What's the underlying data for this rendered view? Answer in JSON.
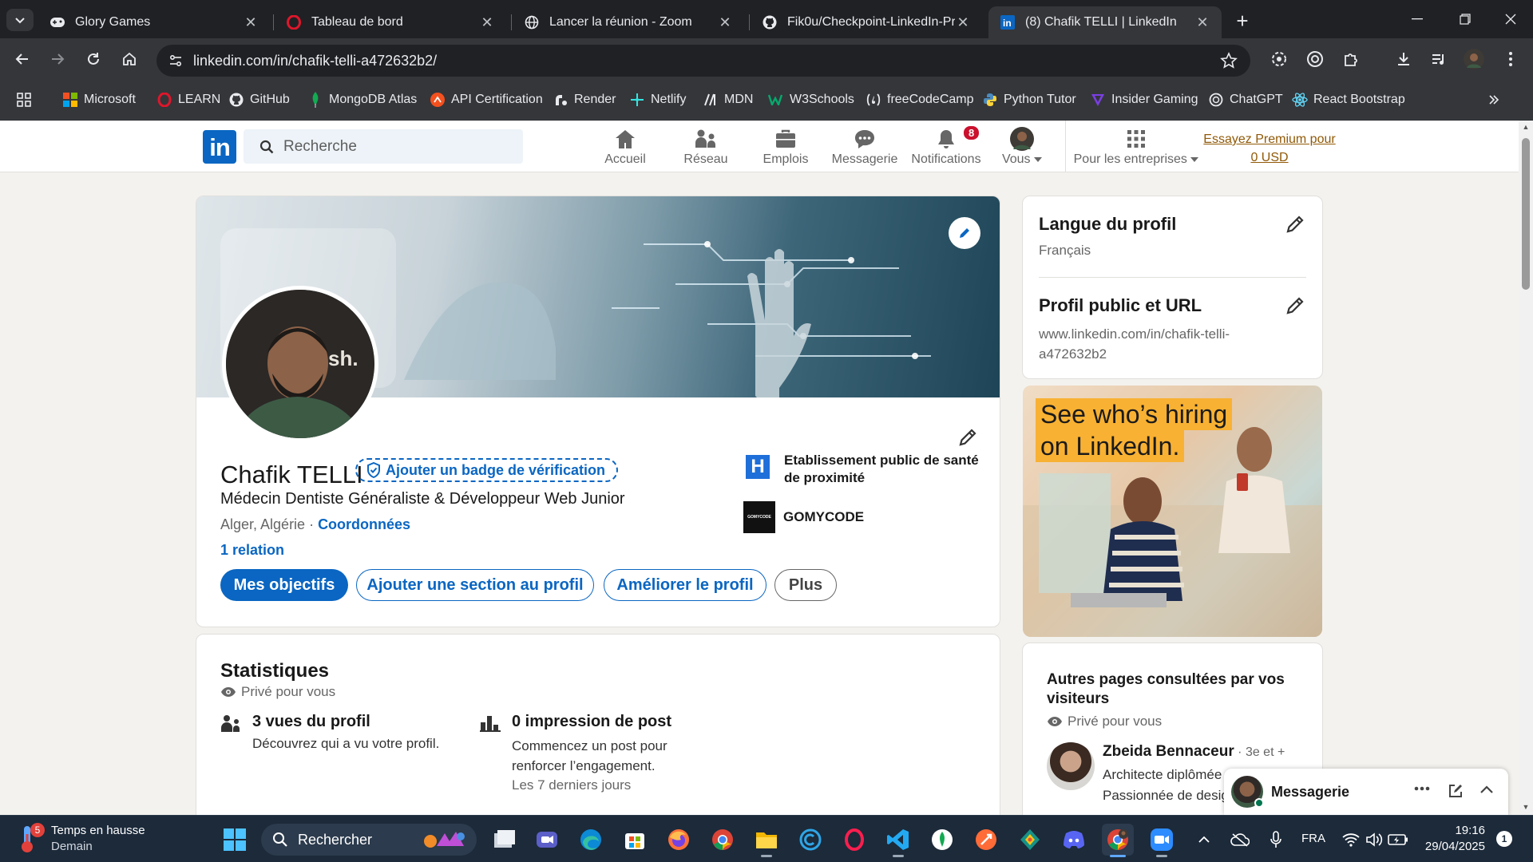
{
  "browser": {
    "tabs": [
      {
        "title": "Glory Games",
        "icon": "gamepad-icon",
        "active": false
      },
      {
        "title": "Tableau de bord",
        "icon": "opera-icon",
        "active": false
      },
      {
        "title": "Lancer la réunion - Zoom",
        "icon": "globe-icon",
        "active": false
      },
      {
        "title": "Fik0u/Checkpoint-LinkedIn-Pro",
        "icon": "github-icon",
        "active": false
      },
      {
        "title": "(8) Chafik TELLI | LinkedIn",
        "icon": "linkedin-icon",
        "active": true
      }
    ],
    "url": "linkedin.com/in/chafik-telli-a472632b2/",
    "bookmarks": [
      {
        "label": "Microsoft",
        "icon": "microsoft-icon",
        "color": "#f25022"
      },
      {
        "label": "LEARN",
        "icon": "opera-icon",
        "color": "#e0162b"
      },
      {
        "label": "GitHub",
        "icon": "github-icon",
        "color": "#ffffff"
      },
      {
        "label": "MongoDB Atlas",
        "icon": "mongodb-icon",
        "color": "#13aa52"
      },
      {
        "label": "API Certification",
        "icon": "api-icon",
        "color": "#f4511e"
      },
      {
        "label": "Render",
        "icon": "render-icon",
        "color": "#ffffff"
      },
      {
        "label": "Netlify",
        "icon": "netlify-icon",
        "color": "#32e6e2"
      },
      {
        "label": "MDN",
        "icon": "mdn-icon",
        "color": "#ffffff"
      },
      {
        "label": "W3Schools",
        "icon": "w3schools-icon",
        "color": "#04aa6d"
      },
      {
        "label": "freeCodeCamp",
        "icon": "freecodecamp-icon",
        "color": "#ffffff"
      },
      {
        "label": "Python Tutor",
        "icon": "python-icon",
        "color": "#4b8bbe"
      },
      {
        "label": "Insider Gaming",
        "icon": "insider-gaming-icon",
        "color": "#7b3fe4"
      },
      {
        "label": "ChatGPT",
        "icon": "chatgpt-icon",
        "color": "#ffffff"
      },
      {
        "label": "React Bootstrap",
        "icon": "react-icon",
        "color": "#61dafb"
      }
    ]
  },
  "linkedin": {
    "search_placeholder": "Recherche",
    "nav": [
      {
        "label": "Accueil",
        "icon": "home-icon"
      },
      {
        "label": "Réseau",
        "icon": "network-icon"
      },
      {
        "label": "Emplois",
        "icon": "briefcase-icon"
      },
      {
        "label": "Messagerie",
        "icon": "messaging-icon"
      },
      {
        "label": "Notifications",
        "icon": "bell-icon",
        "badge": "8"
      },
      {
        "label": "Vous",
        "icon": "avatar-icon"
      },
      {
        "label": "Pour les entreprises",
        "icon": "grid-icon"
      }
    ],
    "premium_line1": "Essayez Premium pour",
    "premium_line2": "0 USD",
    "accent": "#0a66c2"
  },
  "profile": {
    "name": "Chafik TELLI",
    "verify_badge": "Ajouter un badge de vérification",
    "headline": "Médecin Dentiste Généraliste & Développeur Web Junior",
    "location": "Alger, Algérie · ",
    "contact_link": "Coordonnées",
    "connections": "1 relation",
    "buttons": {
      "objectives": "Mes objectifs",
      "add_section": "Ajouter une section au profil",
      "improve": "Améliorer le profil",
      "more": "Plus"
    },
    "orgs": [
      {
        "name": "Etablissement public de santé de proximité",
        "logo_text": "H"
      },
      {
        "name": "GOMYCODE",
        "logo_text": "GOMYCODE"
      }
    ]
  },
  "stats": {
    "title": "Statistiques",
    "privacy": "Privé pour vous",
    "views_title": "3 vues du profil",
    "views_desc": "Découvrez qui a vu votre profil.",
    "impressions_title": "0 impression de post",
    "impressions_desc": "Commencez un post pour renforcer l’engagement.",
    "impressions_period": "Les 7 derniers jours"
  },
  "sidebar": {
    "language_title": "Langue du profil",
    "language_value": "Français",
    "public_title": "Profil public et URL",
    "public_url": "www.linkedin.com/in/chafik-telli-a472632b2",
    "ad_line1": "See who’s hiring",
    "ad_line2": "on LinkedIn.",
    "others_title": "Autres pages consultées par vos visiteurs",
    "others_privacy": "Privé pour vous",
    "person_name": "Zbeida Bennaceur",
    "person_degree": " · 3e et +",
    "person_line1": "Architecte diplômée",
    "person_line2": "Passionnée de design"
  },
  "messaging": {
    "label": "Messagerie"
  },
  "taskbar": {
    "weather_title": "Temps en hausse",
    "weather_sub": "Demain",
    "weather_badge": "5",
    "search": "Rechercher",
    "lang": "FRA",
    "time": "19:16",
    "date": "29/04/2025",
    "notif_count": "1",
    "apps": [
      "files-icon",
      "meet-icon",
      "edge-icon",
      "store-icon",
      "firefox-icon",
      "chrome-icon",
      "explorer-icon",
      "copilot-icon",
      "opera-icon",
      "vscode-icon",
      "mongodb-compass-icon",
      "postman-icon",
      "git-kraken-icon",
      "discord-icon",
      "chrome-profile-icon",
      "zoom-icon"
    ]
  }
}
